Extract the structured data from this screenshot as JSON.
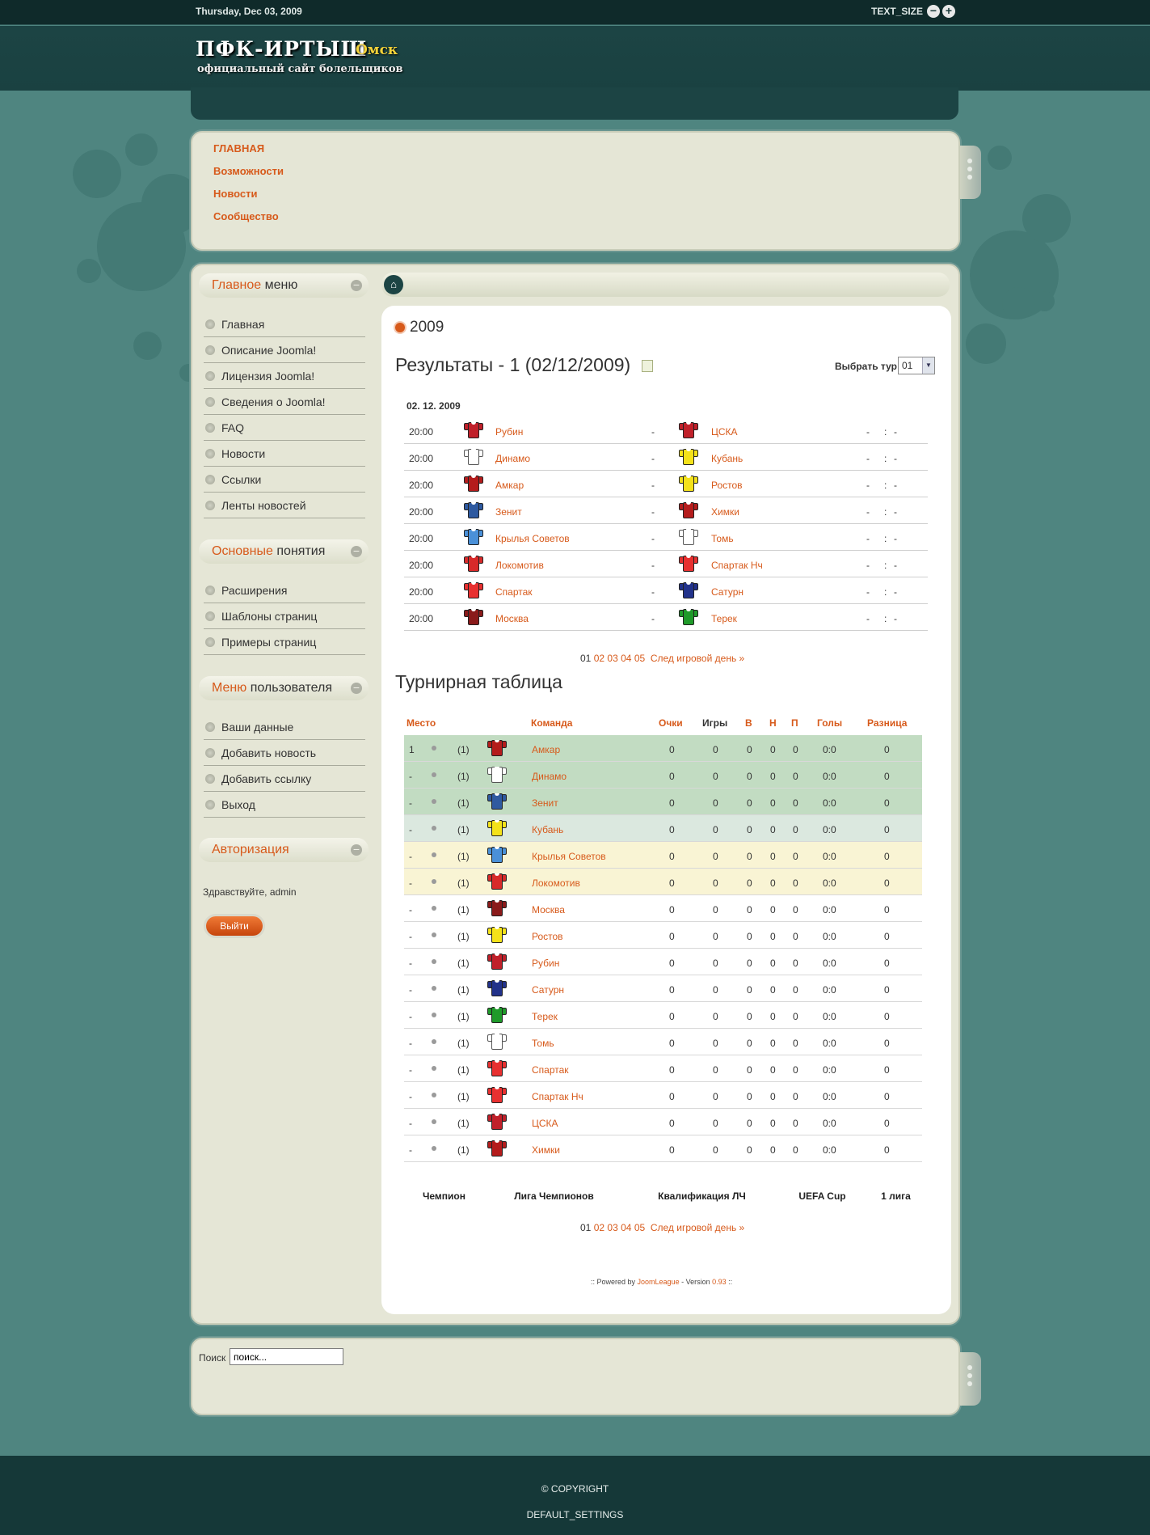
{
  "topbar": {
    "date": "Thursday, Dec 03, 2009",
    "text_size_label": "TEXT_SIZE",
    "decrease": "−",
    "increase": "+"
  },
  "header": {
    "title": "ПФК-ИРТЫШ",
    "city": "Омск",
    "subtitle": "официальный сайт болельщиков"
  },
  "top_menu": [
    "ГЛАВНАЯ",
    "Возможности",
    "Новости",
    "Сообщество"
  ],
  "modules": {
    "main_menu": {
      "title_accent": "Главное",
      "title_rest": "меню",
      "items": [
        "Главная",
        "Описание Joomla!",
        "Лицензия Joomla!",
        "Сведения о Joomla!",
        "FAQ",
        "Новости",
        "Ссылки",
        "Ленты новостей"
      ]
    },
    "basics": {
      "title_accent": "Основные",
      "title_rest": "понятия",
      "items": [
        "Расширения",
        "Шаблоны страниц",
        "Примеры страниц"
      ]
    },
    "user_menu": {
      "title_accent": "Меню",
      "title_rest": "пользователя",
      "items": [
        "Ваши данные",
        "Добавить новость",
        "Добавить ссылку",
        "Выход"
      ]
    },
    "auth": {
      "title_accent": "Авторизация",
      "greeting": "Здравствуйте, admin",
      "logout": "Выйти"
    }
  },
  "content": {
    "season": "2009",
    "results_title": "Результаты - 1 (02/12/2009)",
    "select_label": "Выбрать тур:",
    "select_value": "01",
    "date": "02. 12. 2009",
    "matches": [
      {
        "time": "20:00",
        "home": "Рубин",
        "away": "ЦСКА",
        "home_color": "#c0202a",
        "away_color": "#c0202a"
      },
      {
        "time": "20:00",
        "home": "Динамо",
        "away": "Кубань",
        "home_color": "#ffffff",
        "away_color": "#f4e21a"
      },
      {
        "time": "20:00",
        "home": "Амкар",
        "away": "Ростов",
        "home_color": "#b41c1c",
        "away_color": "#f4e21a"
      },
      {
        "time": "20:00",
        "home": "Зенит",
        "away": "Химки",
        "home_color": "#2f5aa0",
        "away_color": "#b41c1c"
      },
      {
        "time": "20:00",
        "home": "Крылья Советов",
        "away": "Томь",
        "home_color": "#4a90d8",
        "away_color": "#ffffff"
      },
      {
        "time": "20:00",
        "home": "Локомотив",
        "away": "Спартак Нч",
        "home_color": "#d82a2a",
        "away_color": "#e83030"
      },
      {
        "time": "20:00",
        "home": "Спартак",
        "away": "Сатурн",
        "home_color": "#e83030",
        "away_color": "#22328a"
      },
      {
        "time": "20:00",
        "home": "Москва",
        "away": "Терек",
        "home_color": "#8a1a1a",
        "away_color": "#1f9a2a"
      }
    ],
    "match_dash": "-",
    "score_home": "-",
    "score_sep": ":",
    "score_away": "-",
    "pager": {
      "current": "01",
      "pages": [
        "02",
        "03",
        "04",
        "05"
      ],
      "next": "След игровой день »"
    },
    "table_title": "Турнирная таблица",
    "headers": {
      "place": "Место",
      "team": "Команда",
      "points": "Очки",
      "games": "Игры",
      "w": "В",
      "d": "Н",
      "l": "П",
      "goals": "Голы",
      "diff": "Разница"
    },
    "standings": [
      {
        "place": "1",
        "prev": "(1)",
        "team": "Амкар",
        "color": "#b41c1c",
        "bg": "#c2dcc2"
      },
      {
        "place": "-",
        "prev": "(1)",
        "team": "Динамо",
        "color": "#ffffff",
        "bg": "#c2dcc2"
      },
      {
        "place": "-",
        "prev": "(1)",
        "team": "Зенит",
        "color": "#2f5aa0",
        "bg": "#c2dcc2"
      },
      {
        "place": "-",
        "prev": "(1)",
        "team": "Кубань",
        "color": "#f4e21a",
        "bg": "#dbe8df"
      },
      {
        "place": "-",
        "prev": "(1)",
        "team": "Крылья Советов",
        "color": "#4a90d8",
        "bg": "#f9f4d4"
      },
      {
        "place": "-",
        "prev": "(1)",
        "team": "Локомотив",
        "color": "#d82a2a",
        "bg": "#f9f4d4"
      },
      {
        "place": "-",
        "prev": "(1)",
        "team": "Москва",
        "color": "#8a1a1a",
        "bg": "#ffffff"
      },
      {
        "place": "-",
        "prev": "(1)",
        "team": "Ростов",
        "color": "#f4e21a",
        "bg": "#ffffff"
      },
      {
        "place": "-",
        "prev": "(1)",
        "team": "Рубин",
        "color": "#c0202a",
        "bg": "#ffffff"
      },
      {
        "place": "-",
        "prev": "(1)",
        "team": "Сатурн",
        "color": "#22328a",
        "bg": "#ffffff"
      },
      {
        "place": "-",
        "prev": "(1)",
        "team": "Терек",
        "color": "#1f9a2a",
        "bg": "#ffffff"
      },
      {
        "place": "-",
        "prev": "(1)",
        "team": "Томь",
        "color": "#ffffff",
        "bg": "#ffffff"
      },
      {
        "place": "-",
        "prev": "(1)",
        "team": "Спартак",
        "color": "#e83030",
        "bg": "#ffffff"
      },
      {
        "place": "-",
        "prev": "(1)",
        "team": "Спартак Нч",
        "color": "#e83030",
        "bg": "#ffffff"
      },
      {
        "place": "-",
        "prev": "(1)",
        "team": "ЦСКА",
        "color": "#c0202a",
        "bg": "#ffffff"
      },
      {
        "place": "-",
        "prev": "(1)",
        "team": "Химки",
        "color": "#b41c1c",
        "bg": "#ffffff"
      }
    ],
    "zero": "0",
    "goals_zero": "0:0",
    "legend": [
      {
        "label": "Чемпион",
        "bg": "#c2dcc2"
      },
      {
        "label": "Лига Чемпионов",
        "bg": "#c9e0c9"
      },
      {
        "label": "Квалификация ЛЧ",
        "bg": "#dbe8df"
      },
      {
        "label": "UEFA Cup",
        "bg": "#f9f4d4"
      },
      {
        "label": "1 лига",
        "bg": "#f6dcdc"
      }
    ],
    "powered": {
      "prefix": ":: Powered by ",
      "link": "JoomLeague",
      "mid": " - Version ",
      "version": "0.93",
      "suffix": " ::"
    }
  },
  "search": {
    "label": "Поиск",
    "value": "поиск..."
  },
  "footer": {
    "copyright": "© COPYRIGHT",
    "settings": "DEFAULT_SETTINGS"
  }
}
